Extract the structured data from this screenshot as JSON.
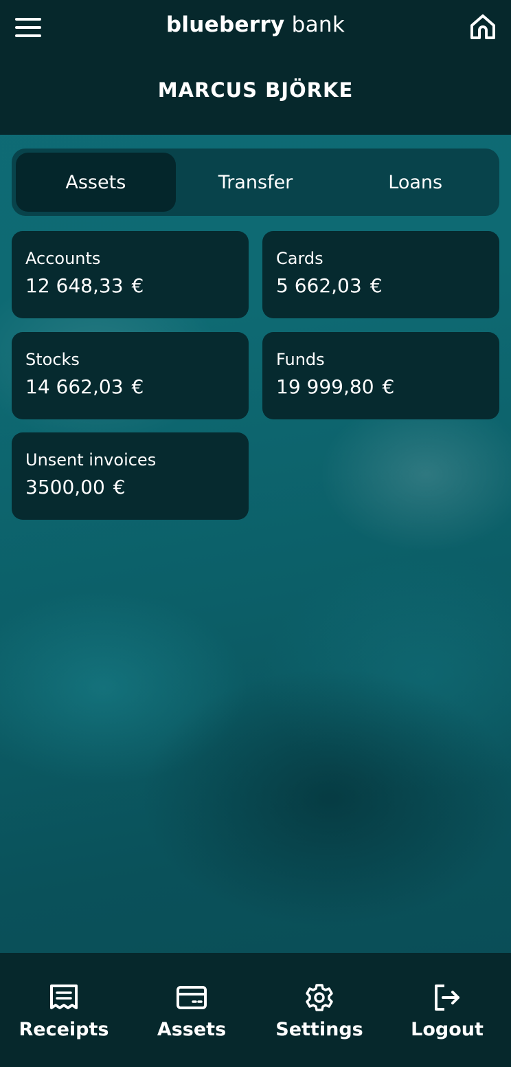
{
  "header": {
    "brand_bold": "blueberry",
    "brand_light": "bank",
    "user_name": "MARCUS BJÖRKE"
  },
  "tabs": [
    {
      "label": "Assets",
      "active": true
    },
    {
      "label": "Transfer",
      "active": false
    },
    {
      "label": "Loans",
      "active": false
    }
  ],
  "cards": [
    {
      "label": "Accounts",
      "amount": "12 648,33",
      "currency": "€"
    },
    {
      "label": "Cards",
      "amount": "5 662,03",
      "currency": "€"
    },
    {
      "label": "Stocks",
      "amount": "14 662,03",
      "currency": "€"
    },
    {
      "label": "Funds",
      "amount": "19 999,80",
      "currency": "€"
    },
    {
      "label": "Unsent invoices",
      "amount": "3500,00",
      "currency": "€"
    }
  ],
  "bottom_nav": [
    {
      "label": "Receipts",
      "icon": "receipt-icon"
    },
    {
      "label": "Assets",
      "icon": "card-icon"
    },
    {
      "label": "Settings",
      "icon": "gear-icon"
    },
    {
      "label": "Logout",
      "icon": "logout-icon"
    }
  ],
  "colors": {
    "header_bg": "#06282c",
    "card_bg": "#062a2f",
    "ocean": "#0c5f68",
    "text": "#ffffff"
  }
}
